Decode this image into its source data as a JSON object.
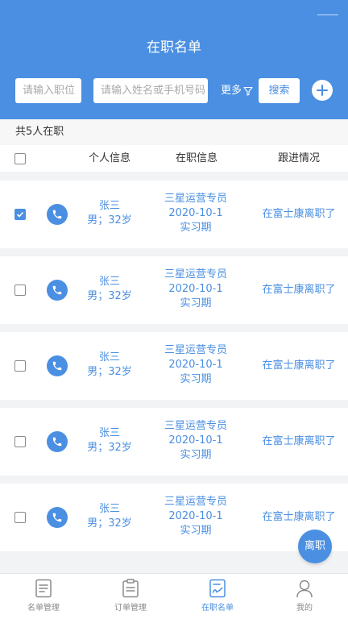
{
  "header": {
    "title": "在职名单",
    "position_placeholder": "请输入职位",
    "name_placeholder": "请输入姓名或手机号码",
    "more_label": "更多",
    "search_label": "搜索"
  },
  "summary": "共5人在职",
  "columns": {
    "personal": "个人信息",
    "job": "在职信息",
    "follow": "跟进情况"
  },
  "rows": [
    {
      "name": "张三",
      "gender_age": "男；32岁",
      "job_title": "三星运营专员",
      "date": "2020-10-1",
      "stage": "实习期",
      "follow": "在富士康离职了",
      "checked": true
    },
    {
      "name": "张三",
      "gender_age": "男；32岁",
      "job_title": "三星运营专员",
      "date": "2020-10-1",
      "stage": "实习期",
      "follow": "在富士康离职了",
      "checked": false
    },
    {
      "name": "张三",
      "gender_age": "男；32岁",
      "job_title": "三星运营专员",
      "date": "2020-10-1",
      "stage": "实习期",
      "follow": "在富士康离职了",
      "checked": false
    },
    {
      "name": "张三",
      "gender_age": "男；32岁",
      "job_title": "三星运营专员",
      "date": "2020-10-1",
      "stage": "实习期",
      "follow": "在富士康离职了",
      "checked": false
    },
    {
      "name": "张三",
      "gender_age": "男；32岁",
      "job_title": "三星运营专员",
      "date": "2020-10-1",
      "stage": "实习期",
      "follow": "在富士康离职了",
      "checked": false
    }
  ],
  "fab_label": "离职",
  "tabs": [
    {
      "label": "名单管理",
      "icon": "document-list-icon",
      "active": false
    },
    {
      "label": "订单管理",
      "icon": "clipboard-icon",
      "active": false
    },
    {
      "label": "在职名单",
      "icon": "signed-document-icon",
      "active": true
    },
    {
      "label": "我的",
      "icon": "user-icon",
      "active": false
    }
  ],
  "colors": {
    "primary": "#4a8fe2",
    "inactive": "#8a8a8a",
    "background": "#f2f3f5"
  }
}
